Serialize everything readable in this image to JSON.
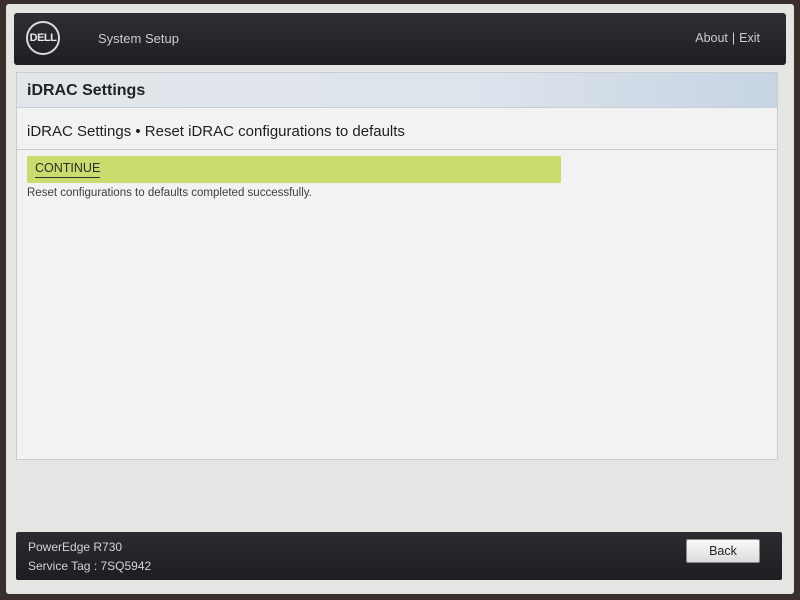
{
  "header": {
    "logo_text": "DELL",
    "app_title": "System Setup",
    "links": {
      "about": "About",
      "separator": "|",
      "exit": "Exit"
    }
  },
  "section": {
    "title": "iDRAC Settings",
    "subtitle": "iDRAC Settings • Reset iDRAC configurations to defaults"
  },
  "action": {
    "continue_label": "CONTINUE",
    "message": "Reset configurations to defaults completed successfully."
  },
  "footer": {
    "model": "PowerEdge R730",
    "service_tag": "Service Tag : 7SQ5942",
    "back_label": "Back"
  },
  "colors": {
    "highlight": "#cbdc6e",
    "header_bg": "#2e2f33"
  }
}
